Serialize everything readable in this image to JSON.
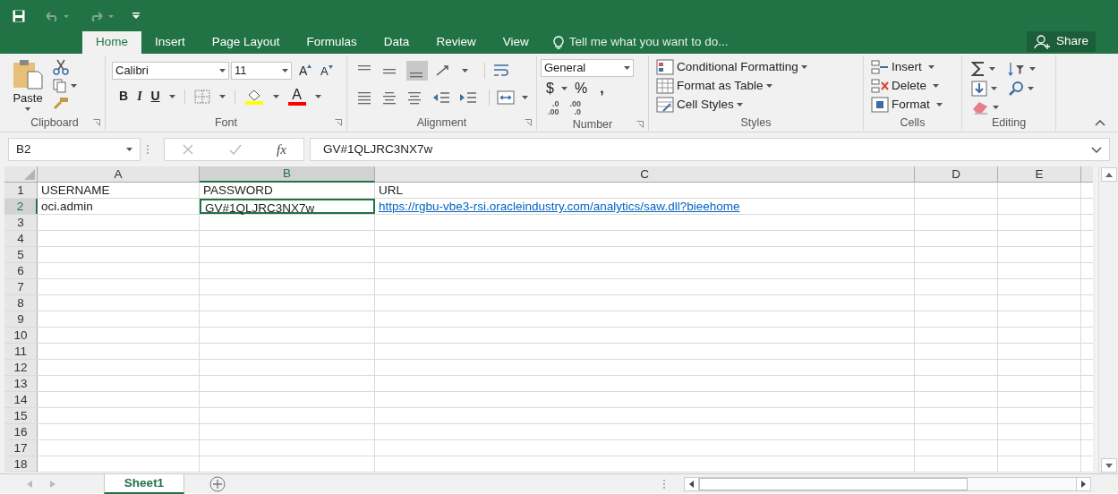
{
  "ribbon_tabs": [
    {
      "label": "Home",
      "selected": true
    },
    {
      "label": "Insert",
      "selected": false
    },
    {
      "label": "Page Layout",
      "selected": false
    },
    {
      "label": "Formulas",
      "selected": false
    },
    {
      "label": "Data",
      "selected": false
    },
    {
      "label": "Review",
      "selected": false
    },
    {
      "label": "View",
      "selected": false
    }
  ],
  "tell_me": "Tell me what you want to do...",
  "share_button": "Share",
  "ribbon_groups": [
    {
      "kind": "clipboard",
      "label": "Clipboard",
      "paste": "Paste"
    },
    {
      "kind": "font",
      "label": "Font",
      "font_name": "Calibri",
      "font_size": "11",
      "grow": "A",
      "shrink": "A",
      "bold": "B",
      "italic": "I",
      "underline": "U",
      "font_color": "A"
    },
    {
      "kind": "alignment",
      "label": "Alignment"
    },
    {
      "kind": "number",
      "label": "Number",
      "format": "General",
      "currency": "$",
      "percent": "%",
      "comma": ",",
      "increase_decimal": [
        ".0",
        ".00"
      ],
      "decrease_decimal": [
        ".00",
        ".0"
      ]
    },
    {
      "kind": "styles",
      "label": "Styles",
      "buttons": [
        "Conditional Formatting",
        "Format as Table",
        "Cell Styles"
      ]
    },
    {
      "kind": "cells",
      "label": "Cells",
      "buttons": [
        "Insert",
        "Delete",
        "Format"
      ]
    },
    {
      "kind": "editing",
      "label": "Editing"
    }
  ],
  "formula_bar": {
    "name_box": "B2",
    "fx": "fx",
    "formula": "GV#1QLJRC3NX7w"
  },
  "columns": [
    {
      "label": "A",
      "selected": false
    },
    {
      "label": "B",
      "selected": true
    },
    {
      "label": "C",
      "selected": false
    },
    {
      "label": "D",
      "selected": false
    },
    {
      "label": "E",
      "selected": false
    }
  ],
  "rows": [
    {
      "header": "1",
      "selected": false,
      "cells": [
        {
          "text": "USERNAME",
          "kind": "text",
          "selected": false
        },
        {
          "text": "PASSWORD",
          "kind": "text",
          "selected": false
        },
        {
          "text": "URL",
          "kind": "text",
          "selected": false
        }
      ]
    },
    {
      "header": "2",
      "selected": true,
      "cells": [
        {
          "text": "oci.admin",
          "kind": "text",
          "selected": false
        },
        {
          "text": "GV#1QLJRC3NX7w",
          "kind": "text",
          "selected": true
        },
        {
          "text": "https://rgbu-vbe3-rsi.oracleindustry.com/analytics/saw.dll?bieehome",
          "kind": "link",
          "selected": false
        }
      ]
    },
    {
      "header": "3",
      "selected": false
    },
    {
      "header": "4",
      "selected": false
    },
    {
      "header": "5",
      "selected": false
    },
    {
      "header": "6",
      "selected": false
    },
    {
      "header": "7",
      "selected": false
    },
    {
      "header": "8",
      "selected": false
    },
    {
      "header": "9",
      "selected": false
    },
    {
      "header": "10",
      "selected": false
    },
    {
      "header": "11",
      "selected": false
    },
    {
      "header": "12",
      "selected": false
    },
    {
      "header": "13",
      "selected": false
    },
    {
      "header": "14",
      "selected": false
    },
    {
      "header": "15",
      "selected": false
    },
    {
      "header": "16",
      "selected": false
    },
    {
      "header": "17",
      "selected": false
    },
    {
      "header": "18",
      "selected": false
    }
  ],
  "sheet_tabs": [
    {
      "label": "Sheet1",
      "selected": true
    }
  ]
}
